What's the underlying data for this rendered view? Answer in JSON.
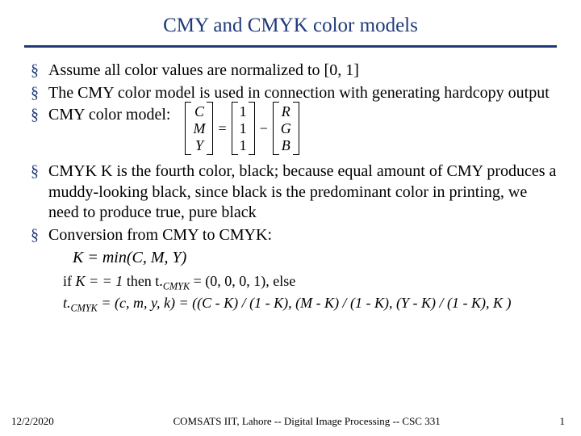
{
  "title": "CMY and CMYK color models",
  "bullets": {
    "b1": "Assume all color values are normalized to [0, 1]",
    "b2": "The CMY color model is used in connection with generating hardcopy output",
    "b3": "CMY color model:",
    "b4": "CMYK  K is the fourth color, black; because equal amount of CMY produces a muddy-looking black, since black is the predominant color in printing, we need to produce true, pure black",
    "b5": "Conversion from CMY to CMYK:"
  },
  "matrix": {
    "cmy": {
      "r1": "C",
      "r2": "M",
      "r3": "Y"
    },
    "ones": {
      "r1": "1",
      "r2": "1",
      "r3": "1"
    },
    "rgb": {
      "r1": "R",
      "r2": "G",
      "r3": "B"
    },
    "eq": "=",
    "minus": "−"
  },
  "equations": {
    "kmin": "K = min(C, M, Y)",
    "if_line_pre": "if ",
    "if_cond": "K = = 1",
    "if_then": " then t.",
    "if_sub": "CMYK",
    "if_rhs": " = (0, 0, 0, 1), else",
    "else_pre": "t.",
    "else_sub": "CMYK",
    "else_rhs": " = (c, m, y, k) = ((C - K) / (1 - K), (M - K) / (1 - K), (Y - K) / (1 - K), K )"
  },
  "footer": {
    "date": "12/2/2020",
    "center": "COMSATS IIT, Lahore  --  Digital Image Processing  --  CSC 331",
    "page": "1"
  }
}
